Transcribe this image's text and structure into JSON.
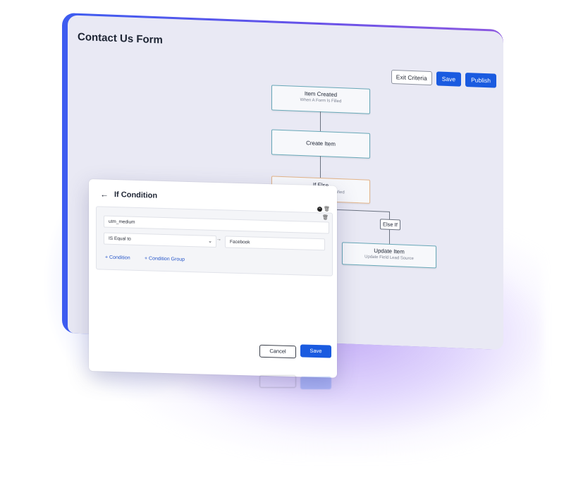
{
  "window": {
    "title": "Contact Us Form",
    "exit_criteria": "Exit Criteria",
    "save": "Save",
    "publish": "Publish"
  },
  "workflow": {
    "nodes": [
      {
        "title": "Item Created",
        "subtitle": "When A Form Is Filled"
      },
      {
        "title": "Create Item",
        "subtitle": ""
      },
      {
        "title": "If Else",
        "subtitle": "When Condition Satisfied"
      },
      {
        "title": "Update Item",
        "subtitle": "Update Field Lead Source"
      }
    ],
    "branch_label": "Else If"
  },
  "dialog": {
    "title": "If Condition",
    "field": "utm_medium",
    "operator": "IS Equal to",
    "value": "Facebook",
    "add_condition": "+ Condition",
    "add_condition_group": "+ Condition Group",
    "cancel": "Cancel",
    "save": "Save"
  },
  "colors": {
    "accent": "#1a5be0",
    "frame_gradient_start": "#3d5cf0",
    "frame_gradient_end": "#8d59e0",
    "node_border": "#68a8b8",
    "ifelse_border": "#e3b58a"
  }
}
